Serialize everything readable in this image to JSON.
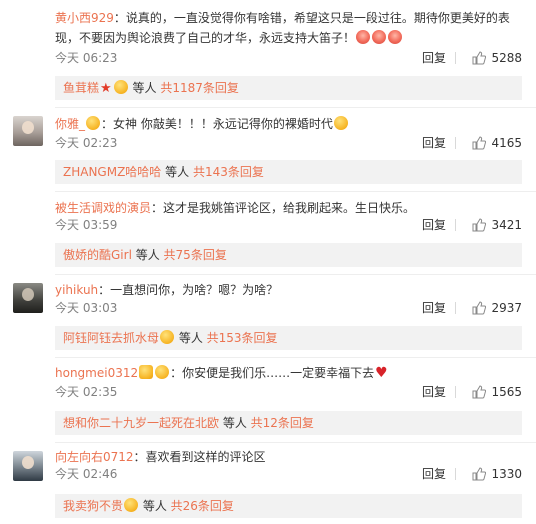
{
  "comments": [
    {
      "name": "黄小西929",
      "body": "：说真的，一直没觉得你有啥错，希望这只是一段过往。期待你更美好的表现，不要因为舆论浪费了自己的才华，永远支持大笛子！",
      "emoji": [
        "cake-emoji",
        "cake-emoji",
        "cake-emoji"
      ],
      "time": "今天 06:23",
      "reply": "回复",
      "likes": "5288",
      "sub": {
        "name": "鱼茸糕",
        "mid": " 等人 ",
        "count": "共1187条回复"
      }
    },
    {
      "name": "你雅_",
      "body": "：女神 你敲美！！！永远记得你的裸婚时代",
      "time": "今天 02:23",
      "reply": "回复",
      "likes": "4165",
      "sub": {
        "name": "ZHANGMZ哈哈哈",
        "mid": " 等人 ",
        "count": "共143条回复"
      }
    },
    {
      "name": "被生活调戏的演员",
      "body": "：这才是我姚笛评论区，给我刷起来。生日快乐。",
      "time": "今天 03:59",
      "reply": "回复",
      "likes": "3421",
      "sub": {
        "name": "傲娇的酷Girl",
        "mid": " 等人 ",
        "count": "共75条回复"
      }
    },
    {
      "name": "yihikuh",
      "body": "：一直想问你，为啥？嗯？为啥？",
      "time": "今天 03:03",
      "reply": "回复",
      "likes": "2937",
      "sub": {
        "name": "阿钰阿钰去抓水母",
        "mid": " 等人 ",
        "count": "共153条回复"
      }
    },
    {
      "name": "hongmei0312",
      "body": "：你安便是我们乐……一定要幸福下去",
      "time": "今天 02:35",
      "reply": "回复",
      "likes": "1565",
      "sub": {
        "name": "想和你二十九岁一起死在北欧",
        "mid": " 等人 ",
        "count": "共12条回复"
      }
    },
    {
      "name": "向左向右0712",
      "body": "：喜欢看到这样的评论区",
      "time": "今天 02:46",
      "reply": "回复",
      "likes": "1330",
      "sub": {
        "name": "我卖狗不贵",
        "mid": " 等人 ",
        "count": "共26条回复"
      }
    }
  ]
}
